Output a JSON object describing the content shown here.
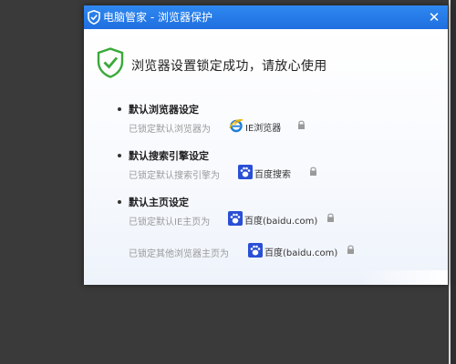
{
  "window": {
    "title": "电脑管家 - 浏览器保护",
    "close_glyph": "✕",
    "accent": "#2a7fe8"
  },
  "headline": "浏览器设置锁定成功，请放心使用",
  "sections": [
    {
      "title": "默认浏览器设定",
      "rows": [
        {
          "label": "已锁定默认浏览器为",
          "value": "IE浏览器",
          "icon": "ie-icon"
        }
      ]
    },
    {
      "title": "默认搜索引擎设定",
      "rows": [
        {
          "label": "已锁定默认搜索引擎为",
          "value": "百度搜索",
          "icon": "baidu-icon"
        }
      ]
    },
    {
      "title": "默认主页设定",
      "rows": [
        {
          "label": "已锁定默认IE主页为",
          "value": "百度(baidu.com)",
          "icon": "baidu-icon"
        },
        {
          "label": "已锁定其他浏览器主页为",
          "value": "百度(baidu.com)",
          "icon": "baidu-icon"
        }
      ]
    }
  ],
  "colors": {
    "success_green": "#3aa93a",
    "baidu_blue": "#2a4fd6",
    "ie_blue": "#1e7fd8",
    "ie_gold": "#f2b600"
  }
}
